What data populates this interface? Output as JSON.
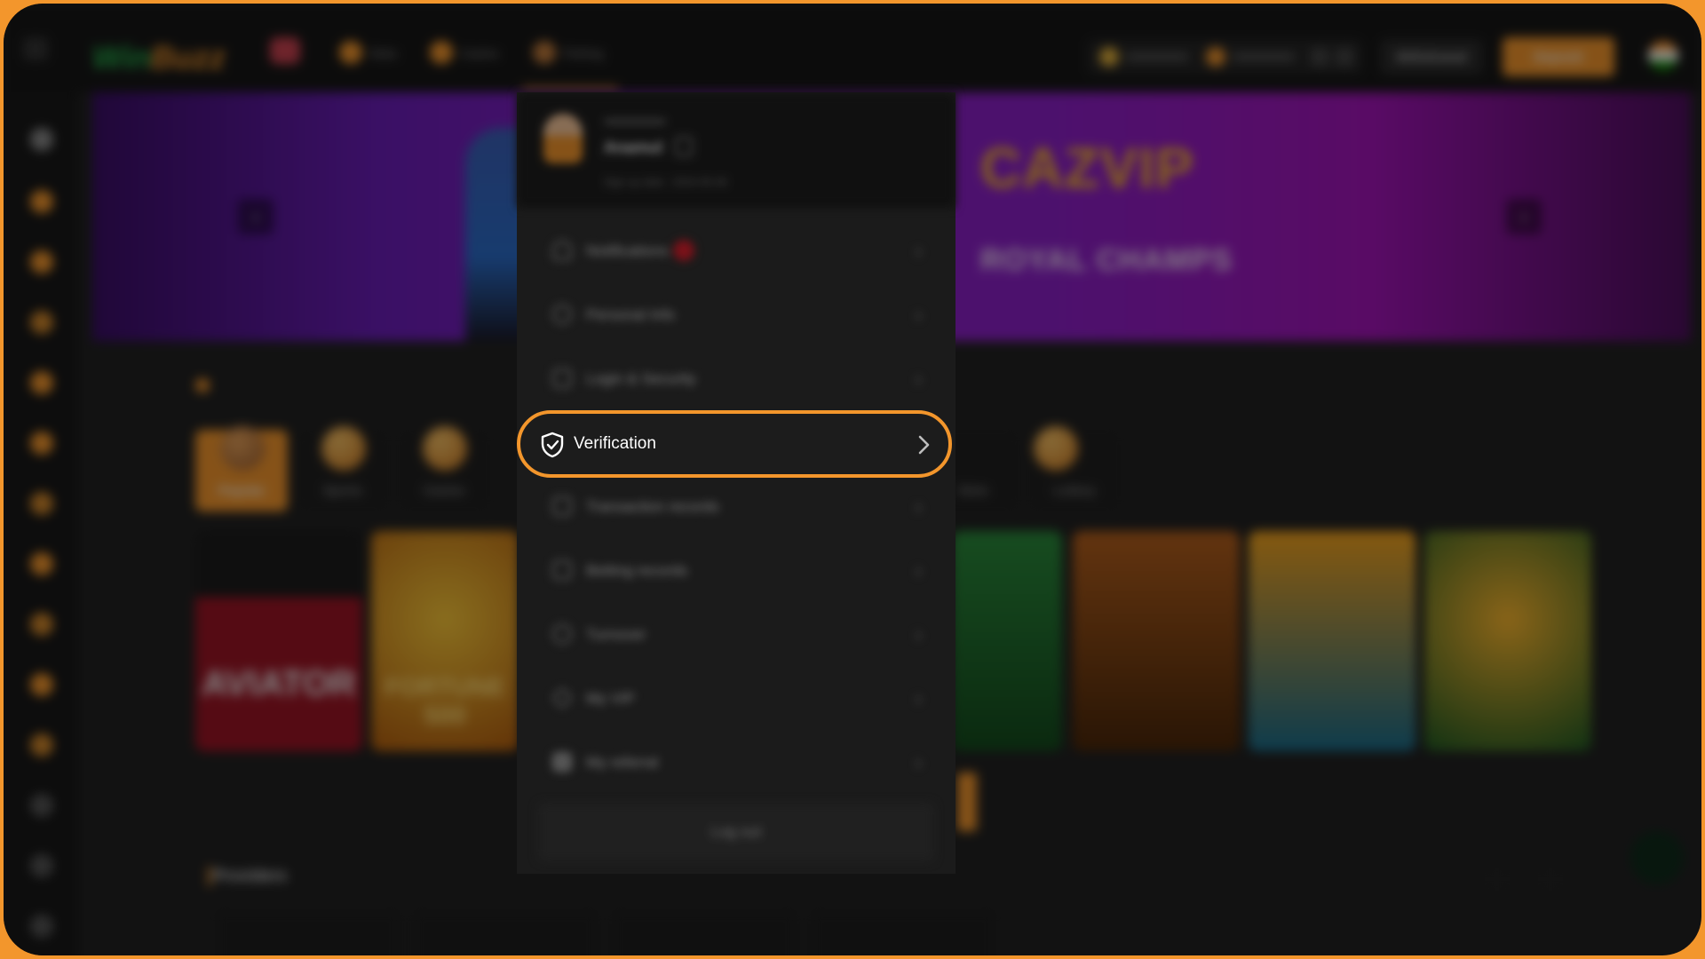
{
  "header": {
    "logo_part1": "Win",
    "logo_part2": "Buzz",
    "nav": [
      "Slots",
      "Casino",
      "Fishing"
    ],
    "withdraw_label": "Withdrawal",
    "deposit_label": "Deposit"
  },
  "banner": {
    "brand": "CAZVIP",
    "subtitle": "ROYAL CHAMPS"
  },
  "categories": [
    "Popular",
    "Sports",
    "Casino",
    "Slots",
    "Lottery"
  ],
  "games": [
    "AVIATOR",
    "FORTUNE 500"
  ],
  "providers_title": "Providers",
  "profile_menu": {
    "username": "Anamul",
    "signup_text": "Sign up date : 2024-05-06",
    "items": [
      {
        "label": "Notifications"
      },
      {
        "label": "Personal Info"
      },
      {
        "label": "Login & Security"
      },
      {
        "label": "Verification"
      },
      {
        "label": "Transaction records"
      },
      {
        "label": "Betting records"
      },
      {
        "label": "Turnover"
      },
      {
        "label": "My VIP"
      },
      {
        "label": "My referral"
      }
    ],
    "logout_label": "Log out"
  },
  "colors": {
    "accent": "#f3962c",
    "background": "#121212",
    "notification_badge": "#e0202e"
  }
}
